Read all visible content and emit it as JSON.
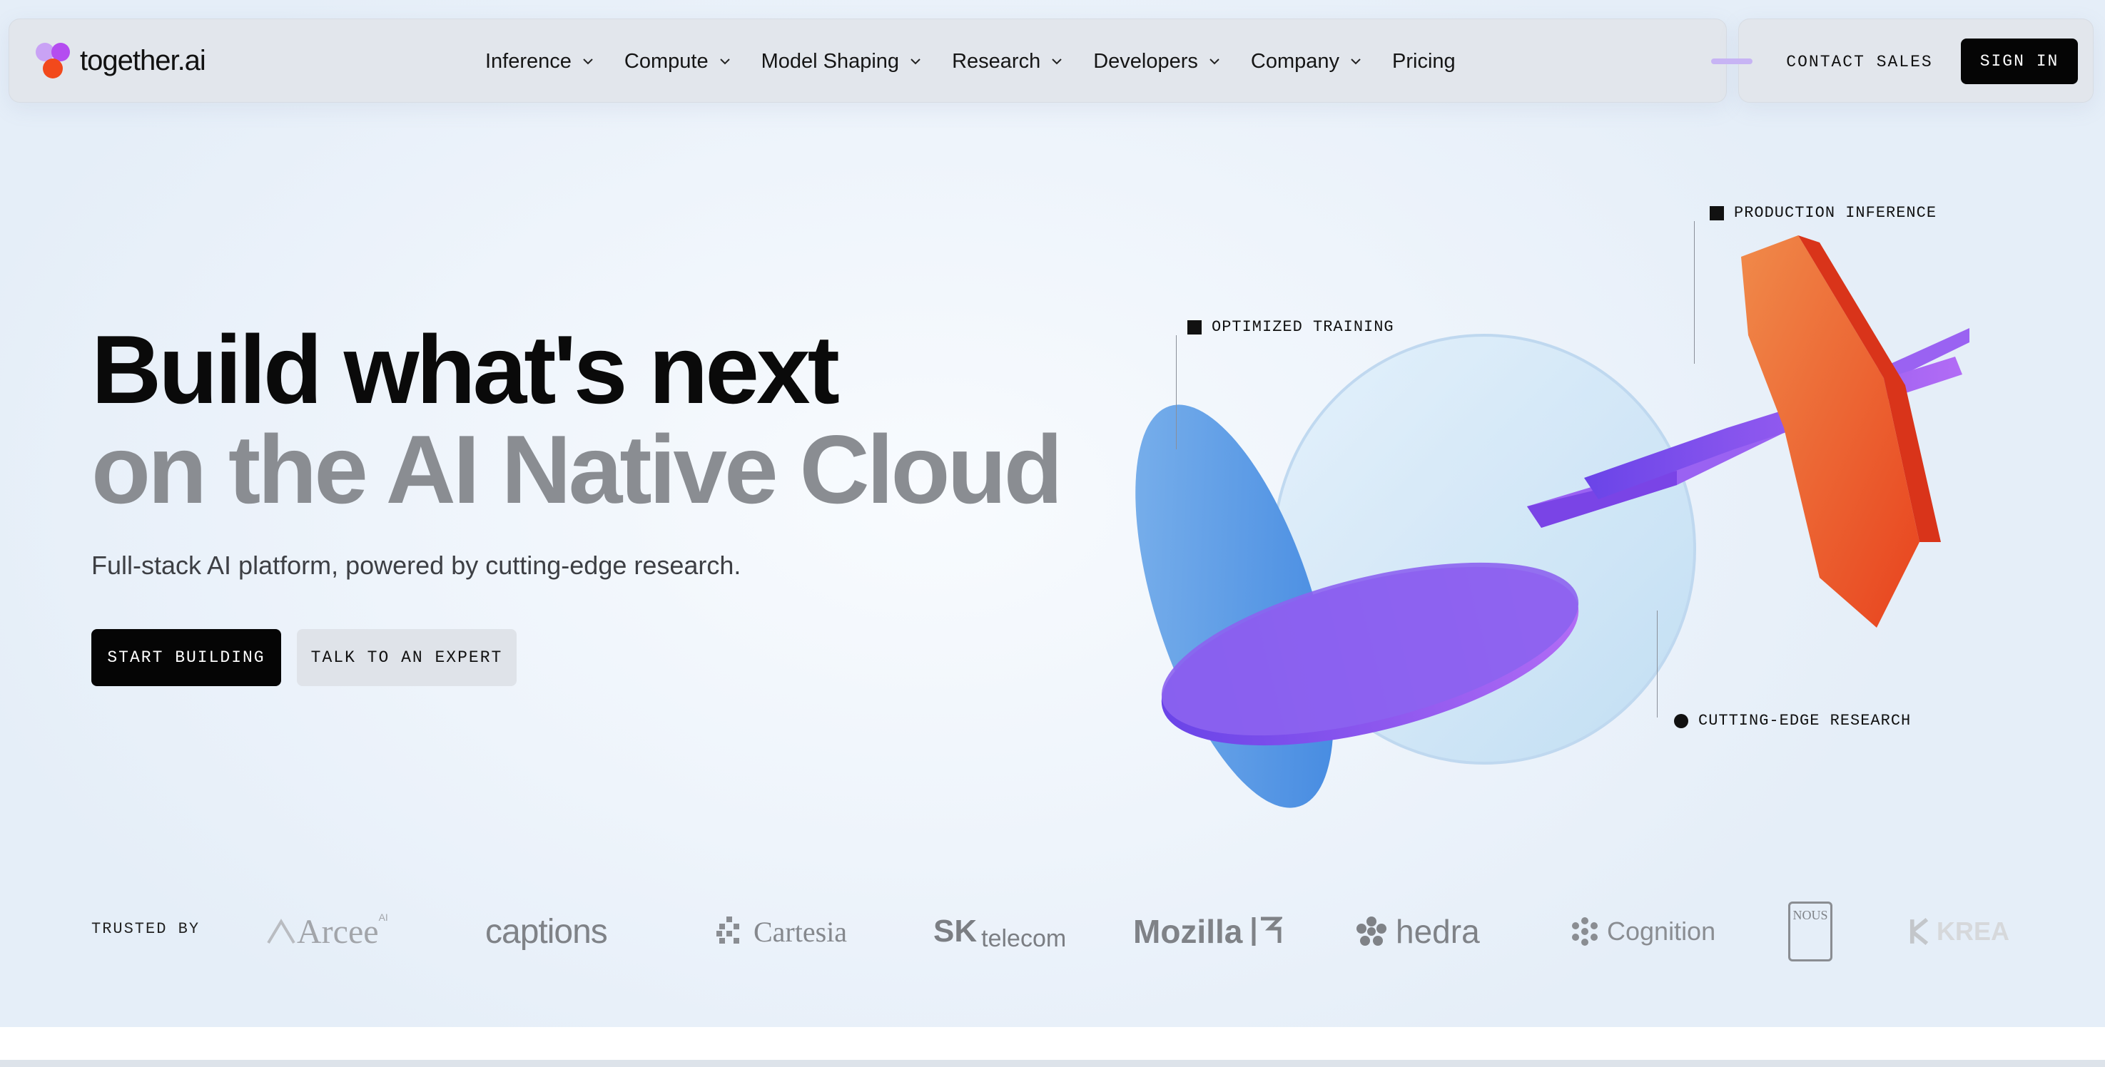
{
  "brand": {
    "name": "together.ai",
    "colors": {
      "accent_purple": "#b44df0",
      "accent_lilac": "#c9a2f5",
      "accent_orange": "#f2491c"
    }
  },
  "nav": {
    "items": [
      {
        "label": "Inference",
        "has_dropdown": true
      },
      {
        "label": "Compute",
        "has_dropdown": true
      },
      {
        "label": "Model Shaping",
        "has_dropdown": true
      },
      {
        "label": "Research",
        "has_dropdown": true
      },
      {
        "label": "Developers",
        "has_dropdown": true
      },
      {
        "label": "Company",
        "has_dropdown": true
      },
      {
        "label": "Pricing",
        "has_dropdown": false
      }
    ],
    "contact_sales": "CONTACT SALES",
    "sign_in": "SIGN IN"
  },
  "hero": {
    "headline_line1": "Build what's next",
    "headline_line2": "on the AI Native Cloud",
    "subheadline": "Full-stack AI platform, powered by cutting-edge research.",
    "primary_cta": "START BUILDING",
    "secondary_cta": "TALK TO AN EXPERT"
  },
  "illustration": {
    "tags": {
      "training": "OPTIMIZED TRAINING",
      "inference": "PRODUCTION INFERENCE",
      "research": "CUTTING-EDGE RESEARCH"
    },
    "colors": {
      "blue": "#5b9be6",
      "glass": "#cfe6f7",
      "purple": "#8a4ff0",
      "red": "#e8451f",
      "orange": "#f07a3a"
    }
  },
  "trusted": {
    "label": "TRUSTED BY",
    "logos": [
      "Arcee",
      "AI",
      "captions",
      "Cartesia",
      "SK",
      "telecom",
      "Mozilla",
      "hedra",
      "Cognition",
      "NOUS",
      "KREA"
    ]
  }
}
